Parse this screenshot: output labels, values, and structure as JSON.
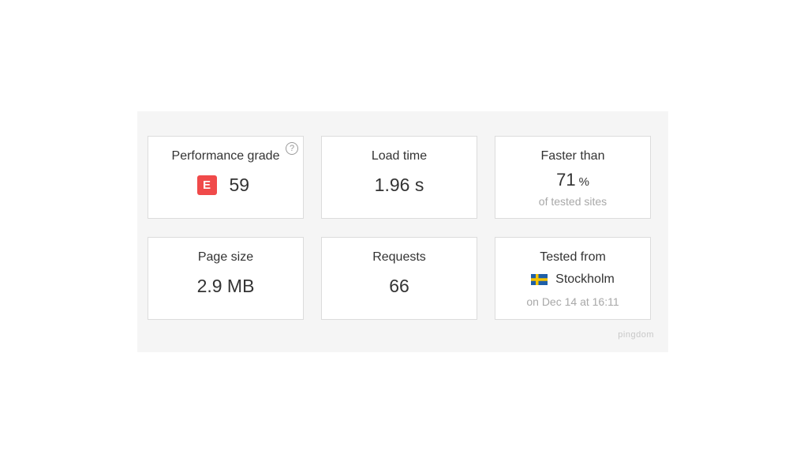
{
  "cards": {
    "performance": {
      "label": "Performance grade",
      "grade_letter": "E",
      "value": "59",
      "help": "?",
      "grade_color": "#f04a4a"
    },
    "load_time": {
      "label": "Load time",
      "value": "1.96 s"
    },
    "faster_than": {
      "label": "Faster than",
      "value": "71",
      "unit": "%",
      "sub": "of tested sites"
    },
    "page_size": {
      "label": "Page size",
      "value": "2.9 MB"
    },
    "requests": {
      "label": "Requests",
      "value": "66"
    },
    "tested_from": {
      "label": "Tested from",
      "location": "Stockholm",
      "flag_icon": "sweden-flag-icon",
      "sub": "on Dec 14 at 16:11"
    }
  },
  "brand": "pingdom"
}
